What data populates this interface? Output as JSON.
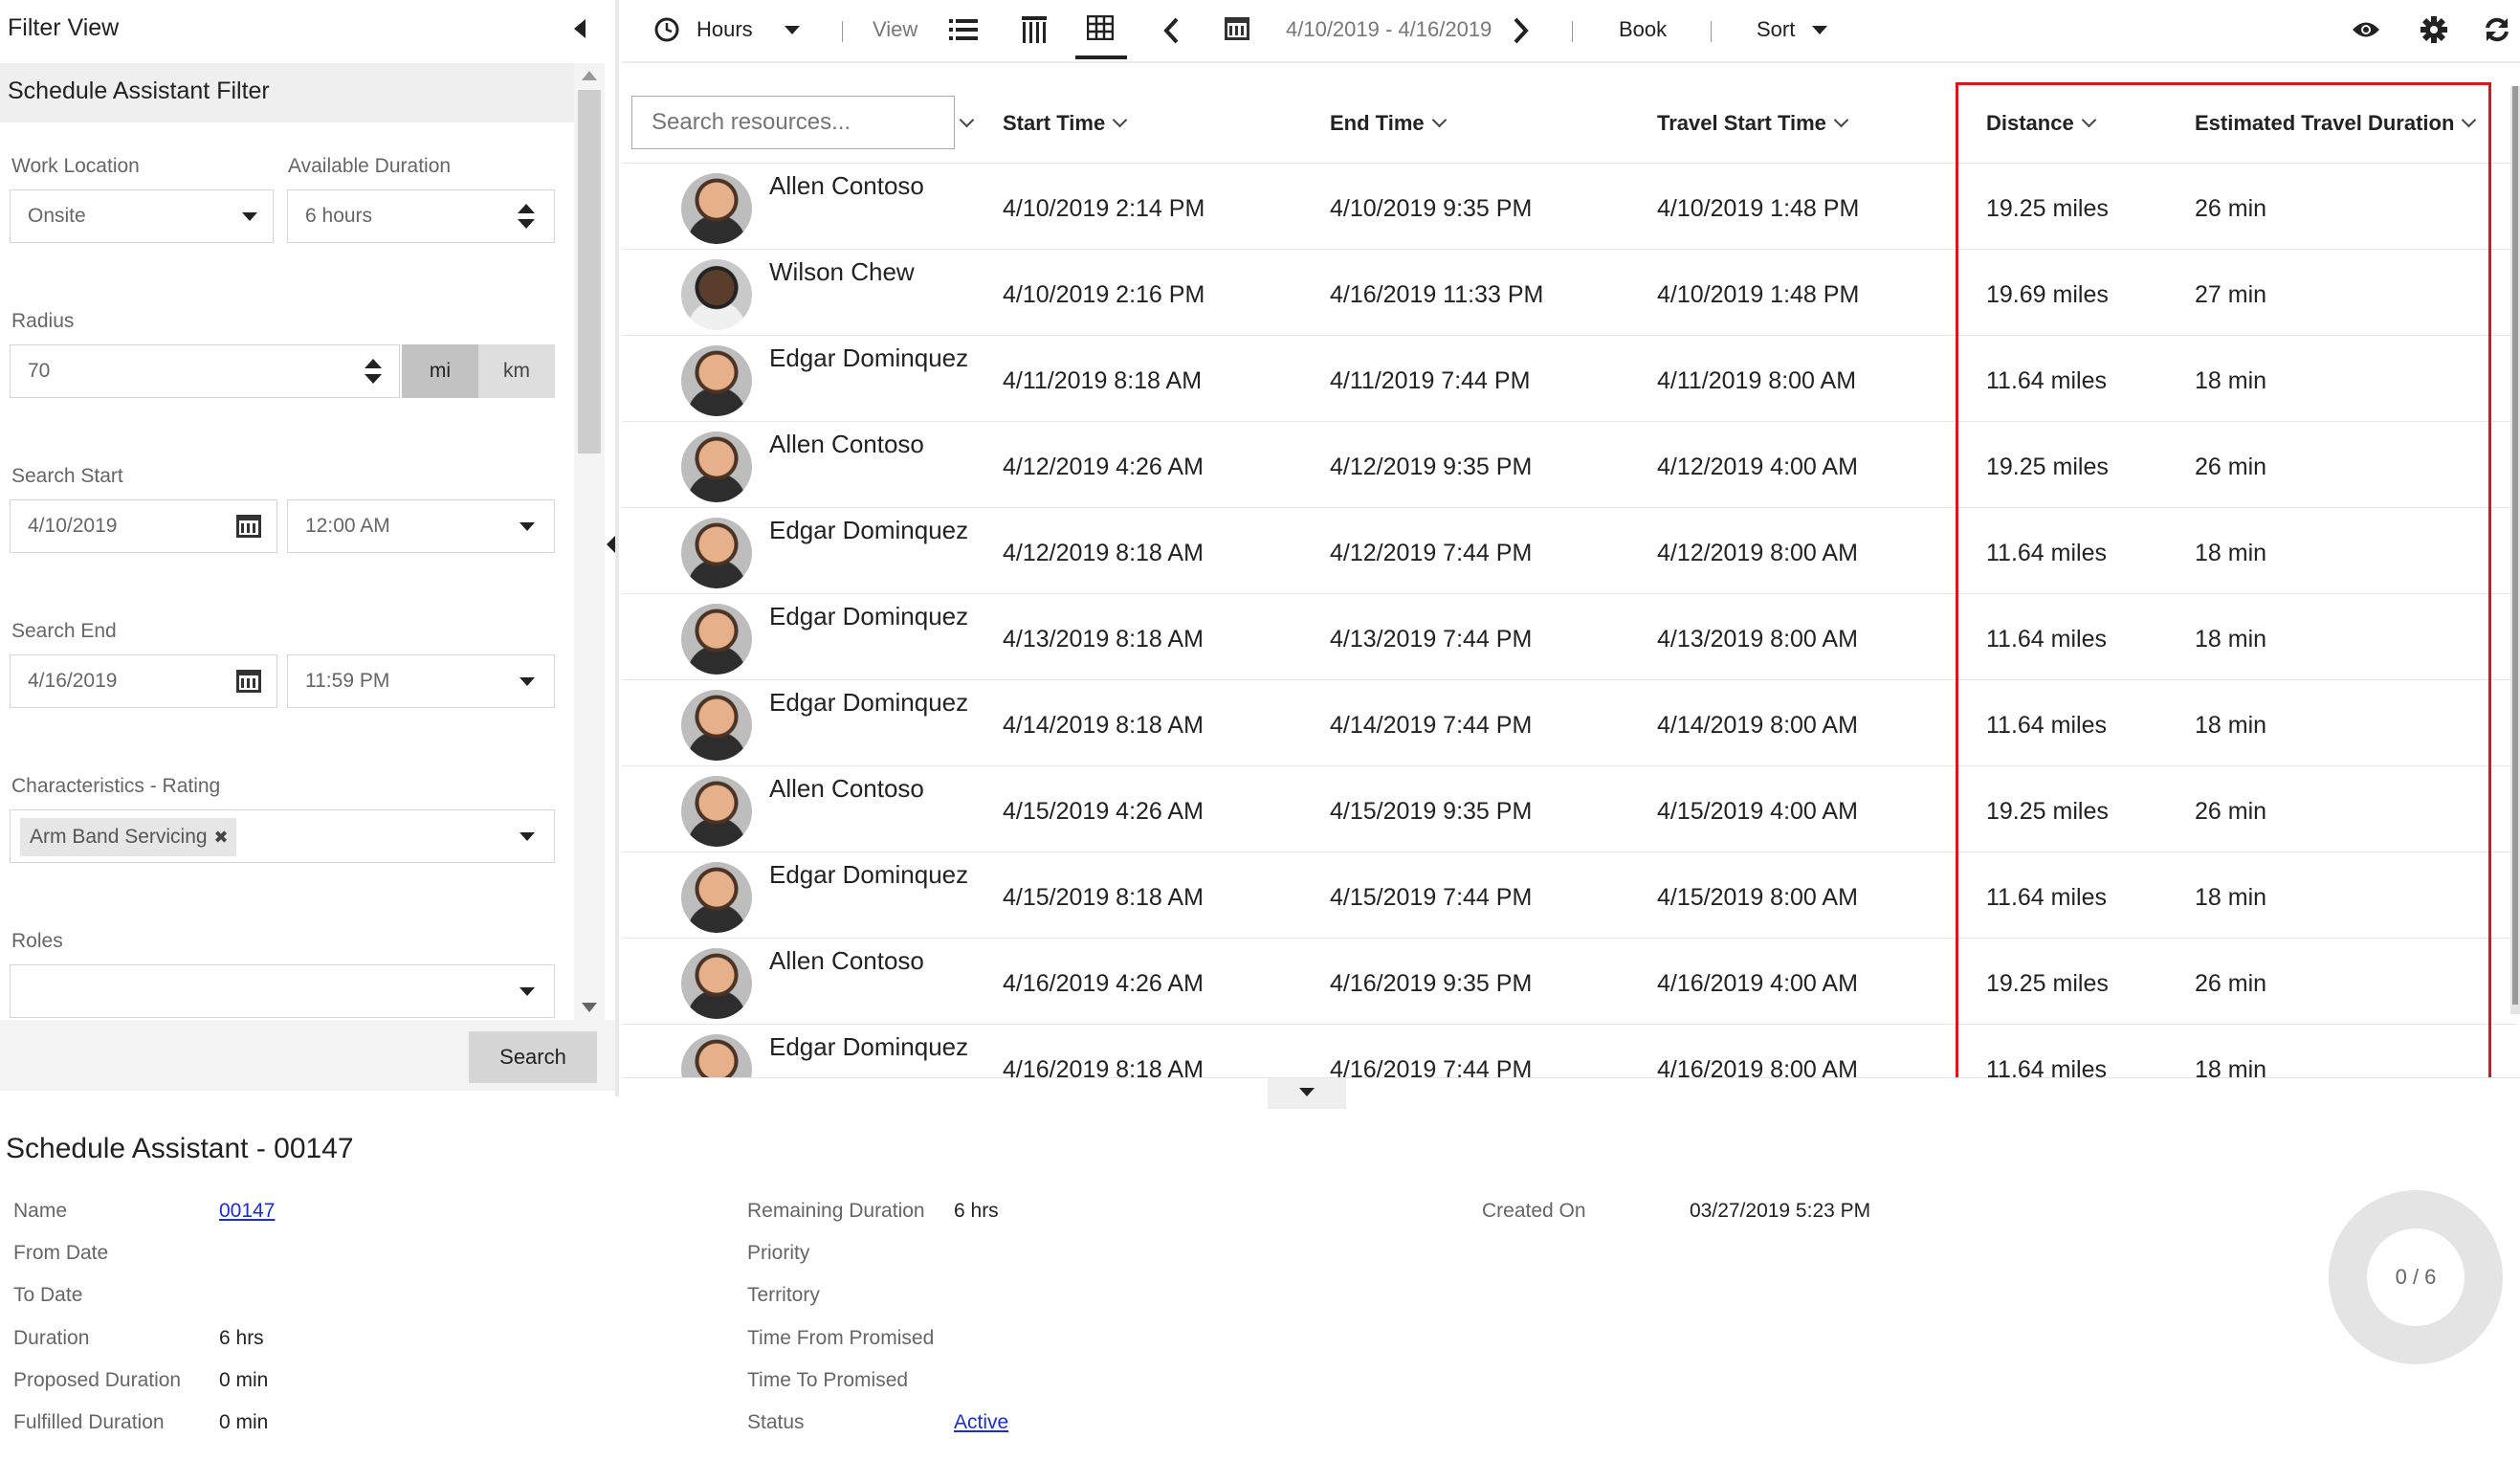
{
  "left_panel": {
    "title": "Filter View",
    "filter_title": "Schedule Assistant Filter",
    "work_location": {
      "label": "Work Location",
      "value": "Onsite"
    },
    "available_duration": {
      "label": "Available Duration",
      "value": "6 hours"
    },
    "radius": {
      "label": "Radius",
      "value": "70",
      "unit_mi": "mi",
      "unit_km": "km",
      "selected_unit": "mi"
    },
    "search_start": {
      "label": "Search Start",
      "date": "4/10/2019",
      "time": "12:00 AM"
    },
    "search_end": {
      "label": "Search End",
      "date": "4/16/2019",
      "time": "11:59 PM"
    },
    "characteristics": {
      "label": "Characteristics - Rating",
      "tag": "Arm Band Servicing",
      "tag_remove": "✖"
    },
    "roles": {
      "label": "Roles",
      "value": ""
    },
    "search_button": "Search"
  },
  "toolbar": {
    "hours_label": "Hours",
    "view_label": "View",
    "date_range": "4/10/2019 - 4/16/2019",
    "book_label": "Book",
    "sort_label": "Sort"
  },
  "grid": {
    "search_placeholder": "Search resources...",
    "columns": {
      "start_time": "Start Time",
      "end_time": "End Time",
      "travel_start_time": "Travel Start Time",
      "distance": "Distance",
      "estimated_travel_duration": "Estimated Travel Duration"
    },
    "rows": [
      {
        "name": "Allen Contoso",
        "start": "4/10/2019 2:14 PM",
        "end": "4/10/2019 9:35 PM",
        "travel_start": "4/10/2019 1:48 PM",
        "distance": "19.25 miles",
        "duration": "26 min"
      },
      {
        "name": "Wilson Chew",
        "start": "4/10/2019 2:16 PM",
        "end": "4/16/2019 11:33 PM",
        "travel_start": "4/10/2019 1:48 PM",
        "distance": "19.69 miles",
        "duration": "27 min"
      },
      {
        "name": "Edgar Dominquez",
        "start": "4/11/2019 8:18 AM",
        "end": "4/11/2019 7:44 PM",
        "travel_start": "4/11/2019 8:00 AM",
        "distance": "11.64 miles",
        "duration": "18 min"
      },
      {
        "name": "Allen Contoso",
        "start": "4/12/2019 4:26 AM",
        "end": "4/12/2019 9:35 PM",
        "travel_start": "4/12/2019 4:00 AM",
        "distance": "19.25 miles",
        "duration": "26 min"
      },
      {
        "name": "Edgar Dominquez",
        "start": "4/12/2019 8:18 AM",
        "end": "4/12/2019 7:44 PM",
        "travel_start": "4/12/2019 8:00 AM",
        "distance": "11.64 miles",
        "duration": "18 min"
      },
      {
        "name": "Edgar Dominquez",
        "start": "4/13/2019 8:18 AM",
        "end": "4/13/2019 7:44 PM",
        "travel_start": "4/13/2019 8:00 AM",
        "distance": "11.64 miles",
        "duration": "18 min"
      },
      {
        "name": "Edgar Dominquez",
        "start": "4/14/2019 8:18 AM",
        "end": "4/14/2019 7:44 PM",
        "travel_start": "4/14/2019 8:00 AM",
        "distance": "11.64 miles",
        "duration": "18 min"
      },
      {
        "name": "Allen Contoso",
        "start": "4/15/2019 4:26 AM",
        "end": "4/15/2019 9:35 PM",
        "travel_start": "4/15/2019 4:00 AM",
        "distance": "19.25 miles",
        "duration": "26 min"
      },
      {
        "name": "Edgar Dominquez",
        "start": "4/15/2019 8:18 AM",
        "end": "4/15/2019 7:44 PM",
        "travel_start": "4/15/2019 8:00 AM",
        "distance": "11.64 miles",
        "duration": "18 min"
      },
      {
        "name": "Allen Contoso",
        "start": "4/16/2019 4:26 AM",
        "end": "4/16/2019 9:35 PM",
        "travel_start": "4/16/2019 4:00 AM",
        "distance": "19.25 miles",
        "duration": "26 min"
      },
      {
        "name": "Edgar Dominquez",
        "start": "4/16/2019 8:18 AM",
        "end": "4/16/2019 7:44 PM",
        "travel_start": "4/16/2019 8:00 AM",
        "distance": "11.64 miles",
        "duration": "18 min"
      }
    ]
  },
  "detail": {
    "title": "Schedule Assistant - 00147",
    "name_label": "Name",
    "name_value": "00147",
    "from_date_label": "From Date",
    "to_date_label": "To Date",
    "duration_label": "Duration",
    "duration_value": "6 hrs",
    "proposed_duration_label": "Proposed Duration",
    "proposed_duration_value": "0 min",
    "fulfilled_duration_label": "Fulfilled Duration",
    "fulfilled_duration_value": "0 min",
    "remaining_duration_label": "Remaining Duration",
    "remaining_duration_value": "6 hrs",
    "priority_label": "Priority",
    "territory_label": "Territory",
    "time_from_promised_label": "Time From Promised",
    "time_to_promised_label": "Time To Promised",
    "status_label": "Status",
    "status_value": "Active",
    "created_on_label": "Created On",
    "created_on_value": "03/27/2019 5:23 PM",
    "progress": "0 / 6"
  },
  "colors": {
    "highlight": "#d9171c",
    "link": "#1a2fd2",
    "panel_gray": "#efefef"
  },
  "icons": [
    "clock-icon",
    "list-view-icon",
    "vertical-view-icon",
    "grid-view-icon",
    "calendar-icon",
    "eye-icon",
    "gear-icon",
    "refresh-icon"
  ]
}
